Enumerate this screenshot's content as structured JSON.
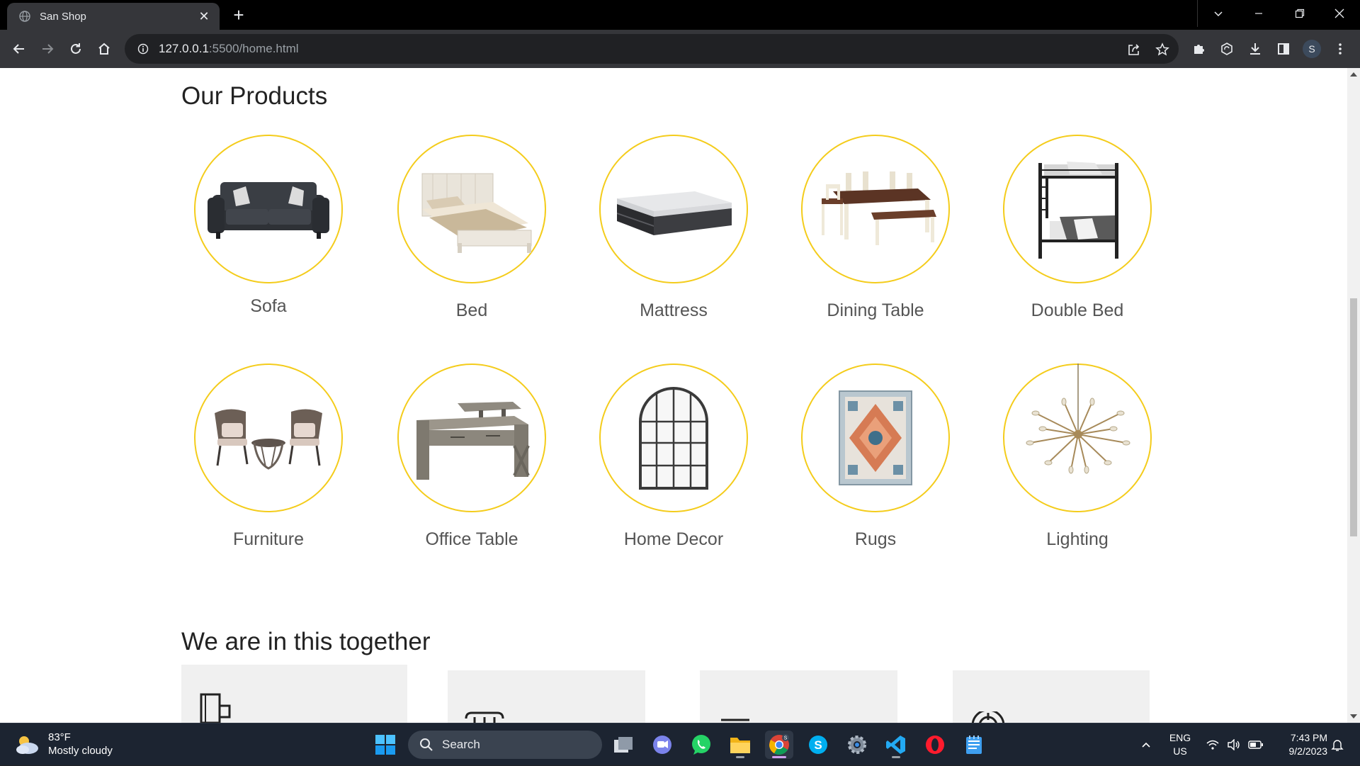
{
  "browser": {
    "tab_title": "San Shop",
    "new_tab_symbol": "+",
    "url_host": "127.0.0.1",
    "url_path": ":5500/home.html",
    "profile_initial": "S"
  },
  "page": {
    "products_heading": "Our Products",
    "products": [
      {
        "label": "Sofa",
        "icon": "sofa-image"
      },
      {
        "label": "Bed",
        "icon": "bed-image"
      },
      {
        "label": "Mattress",
        "icon": "mattress-image"
      },
      {
        "label": "Dining Table",
        "icon": "dining-table-image"
      },
      {
        "label": "Double Bed",
        "icon": "bunk-bed-image"
      },
      {
        "label": "Furniture",
        "icon": "patio-furniture-image"
      },
      {
        "label": "Office Table",
        "icon": "office-table-image"
      },
      {
        "label": "Home Decor",
        "icon": "arched-mirror-image"
      },
      {
        "label": "Rugs",
        "icon": "rug-image"
      },
      {
        "label": "Lighting",
        "icon": "chandelier-image"
      }
    ],
    "together_heading": "We are in this together"
  },
  "taskbar": {
    "weather_temp": "83°F",
    "weather_desc": "Mostly cloudy",
    "search_label": "Search",
    "skype_badge": "S",
    "chrome_badge": "S",
    "lang_top": "ENG",
    "lang_bottom": "US",
    "time": "7:43 PM",
    "date": "9/2/2023"
  },
  "colors": {
    "circle_border": "#f4cc1b",
    "heading": "#222222",
    "label": "#555555",
    "card_bg": "#f0f0f0"
  }
}
